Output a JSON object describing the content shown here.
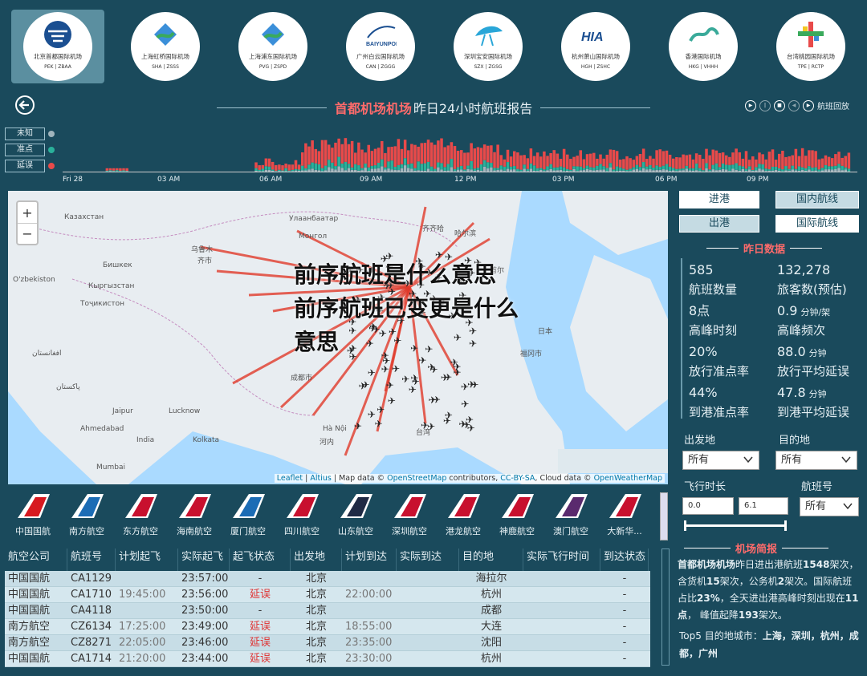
{
  "airports": [
    {
      "name": "北京首都国际机场",
      "codes": "PEK | ZBAA",
      "selected": true
    },
    {
      "name": "上海虹桥国际机场",
      "codes": "SHA | ZSSS"
    },
    {
      "name": "上海浦东国际机场",
      "codes": "PVG | ZSPD"
    },
    {
      "name": "广州白云国际机场",
      "codes": "CAN | ZGGG"
    },
    {
      "name": "深圳宝安国际机场",
      "codes": "SZX | ZGSG"
    },
    {
      "name": "杭州萧山国际机场",
      "codes": "HGH | ZSHC"
    },
    {
      "name": "香港国际机场",
      "codes": "HKG | VHHH"
    },
    {
      "name": "台湾桃园国际机场",
      "codes": "TPE | RCTP"
    }
  ],
  "logo_texts": {
    "baiyun": "BAIYUNPORT",
    "hia": "HIA"
  },
  "header": {
    "title_highlight": "首都机场机场",
    "title_rest": "昨日24小时航班报告",
    "replay_label": "航班回放"
  },
  "legend": [
    {
      "label": "未知",
      "color": "#a0b4bc"
    },
    {
      "label": "准点",
      "color": "#2ab19a"
    },
    {
      "label": "延误",
      "color": "#e84a4a"
    }
  ],
  "histogram": {
    "ticks": [
      "Fri 28",
      "03 AM",
      "06 AM",
      "09 AM",
      "12 PM",
      "03 PM",
      "06 PM",
      "09 PM"
    ],
    "series_colors": {
      "unknown": "#a0b4bc",
      "ontime": "#2ab19a",
      "delayed": "#e84a4a"
    }
  },
  "map": {
    "zoom_in": "+",
    "zoom_out": "−",
    "attribution": {
      "a": "Leaflet",
      "b": "Altius",
      "c": "Map data ©",
      "d": "OpenStreetMap",
      "e": "contributors,",
      "f": "CC-BY-SA",
      "g": ", Cloud data ©",
      "h": "OpenWeatherMap"
    },
    "labels": [
      "Казахстан",
      "Улаанбаатар",
      "Монгол",
      "齐齐哈",
      "哈尔滨",
      "乌鲁木",
      "齐市",
      "Бишкек",
      "Кыргызстан",
      "O'zbekiston",
      "Тоҷикистон",
      "افغانستان",
      "پاکستان",
      "Jaipur",
      "Ahmedabad",
      "Lucknow",
      "India",
      "Kolkata",
      "Mumbai",
      "成都市",
      "河内",
      "Hà Nội",
      "福冈市",
      "日本",
      "台湾",
      "首尔"
    ]
  },
  "overlay": {
    "line1": "前序航班是什么意思",
    "line2": "前序航班已变更是什么",
    "line3": "意思"
  },
  "toggles": {
    "in": "进港",
    "out": "出港",
    "domestic": "国内航线",
    "intl": "国际航线"
  },
  "yesterday": {
    "title": "昨日数据",
    "kpis": [
      {
        "value": "585",
        "unit": "",
        "label": "航班数量"
      },
      {
        "value": "132,278",
        "unit": "",
        "label": "旅客数(预估)"
      },
      {
        "value": "8点",
        "unit": "",
        "label": "高峰时刻"
      },
      {
        "value": "0.9",
        "unit": "分钟/架",
        "label": "高峰频次"
      },
      {
        "value": "20%",
        "unit": "",
        "label": "放行准点率"
      },
      {
        "value": "88.0",
        "unit": "分钟",
        "label": "放行平均延误"
      },
      {
        "value": "44%",
        "unit": "",
        "label": "到港准点率"
      },
      {
        "value": "47.8",
        "unit": "分钟",
        "label": "到港平均延误"
      }
    ]
  },
  "filters": {
    "dep_label": "出发地",
    "dep_value": "所有",
    "dest_label": "目的地",
    "dest_value": "所有",
    "duration_label": "飞行时长",
    "duration_min": "0.0",
    "duration_max": "6.1",
    "flightno_label": "航班号",
    "flightno_value": "所有"
  },
  "airlines": [
    {
      "name": "中国国航",
      "color": "#d71920"
    },
    {
      "name": "南方航空",
      "color": "#1b6cb5"
    },
    {
      "name": "东方航空",
      "color": "#c8102e"
    },
    {
      "name": "海南航空",
      "color": "#c8102e"
    },
    {
      "name": "厦门航空",
      "color": "#1b6cb5"
    },
    {
      "name": "四川航空",
      "color": "#c8102e"
    },
    {
      "name": "山东航空",
      "color": "#1f2a44"
    },
    {
      "name": "深圳航空",
      "color": "#c8102e"
    },
    {
      "name": "港龙航空",
      "color": "#c8102e"
    },
    {
      "name": "神鹿航空",
      "color": "#c8102e"
    },
    {
      "name": "澳门航空",
      "color": "#5a2a6e"
    },
    {
      "name": "大新华...",
      "color": "#c8102e"
    }
  ],
  "table": {
    "columns": [
      "航空公司",
      "航班号",
      "计划起飞",
      "实际起飞",
      "起飞状态",
      "出发地",
      "计划到达",
      "实际到达",
      "目的地",
      "实际飞行时间",
      "到达状态"
    ],
    "rows": [
      [
        "中国国航",
        "CA1129",
        "",
        "23:57:00",
        "-",
        "北京",
        "",
        "",
        "海拉尔",
        "",
        "-"
      ],
      [
        "中国国航",
        "CA1710",
        "19:45:00",
        "23:56:00",
        "延误",
        "北京",
        "22:00:00",
        "",
        "杭州",
        "",
        "-"
      ],
      [
        "中国国航",
        "CA4118",
        "",
        "23:50:00",
        "-",
        "北京",
        "",
        "",
        "成都",
        "",
        "-"
      ],
      [
        "南方航空",
        "CZ6134",
        "17:25:00",
        "23:49:00",
        "延误",
        "北京",
        "18:55:00",
        "",
        "大连",
        "",
        "-"
      ],
      [
        "南方航空",
        "CZ8271",
        "22:05:00",
        "23:46:00",
        "延误",
        "北京",
        "23:35:00",
        "",
        "沈阳",
        "",
        "-"
      ],
      [
        "中国国航",
        "CA1714",
        "21:20:00",
        "23:44:00",
        "延误",
        "北京",
        "23:30:00",
        "",
        "杭州",
        "",
        "-"
      ]
    ]
  },
  "brief": {
    "title": "机场简报",
    "p_name": "首都机场机场",
    "p1": "昨日进出港航班",
    "p_total": "1548",
    "p2": "架次，含货机",
    "p_cargo": "15",
    "p3": "架次，公务机",
    "p_biz": "2",
    "p4": "架次。国际航班占比",
    "p_intl": "23%",
    "p5": "，全天进出港高峰时刻出现在",
    "p_peak": "11点",
    "p6": "，  峰值起降",
    "p_peakn": "193",
    "p7": "架次。",
    "top5_label": "Top5 目的地城市：",
    "top5": "上海，深圳，杭州，成都，广州"
  }
}
